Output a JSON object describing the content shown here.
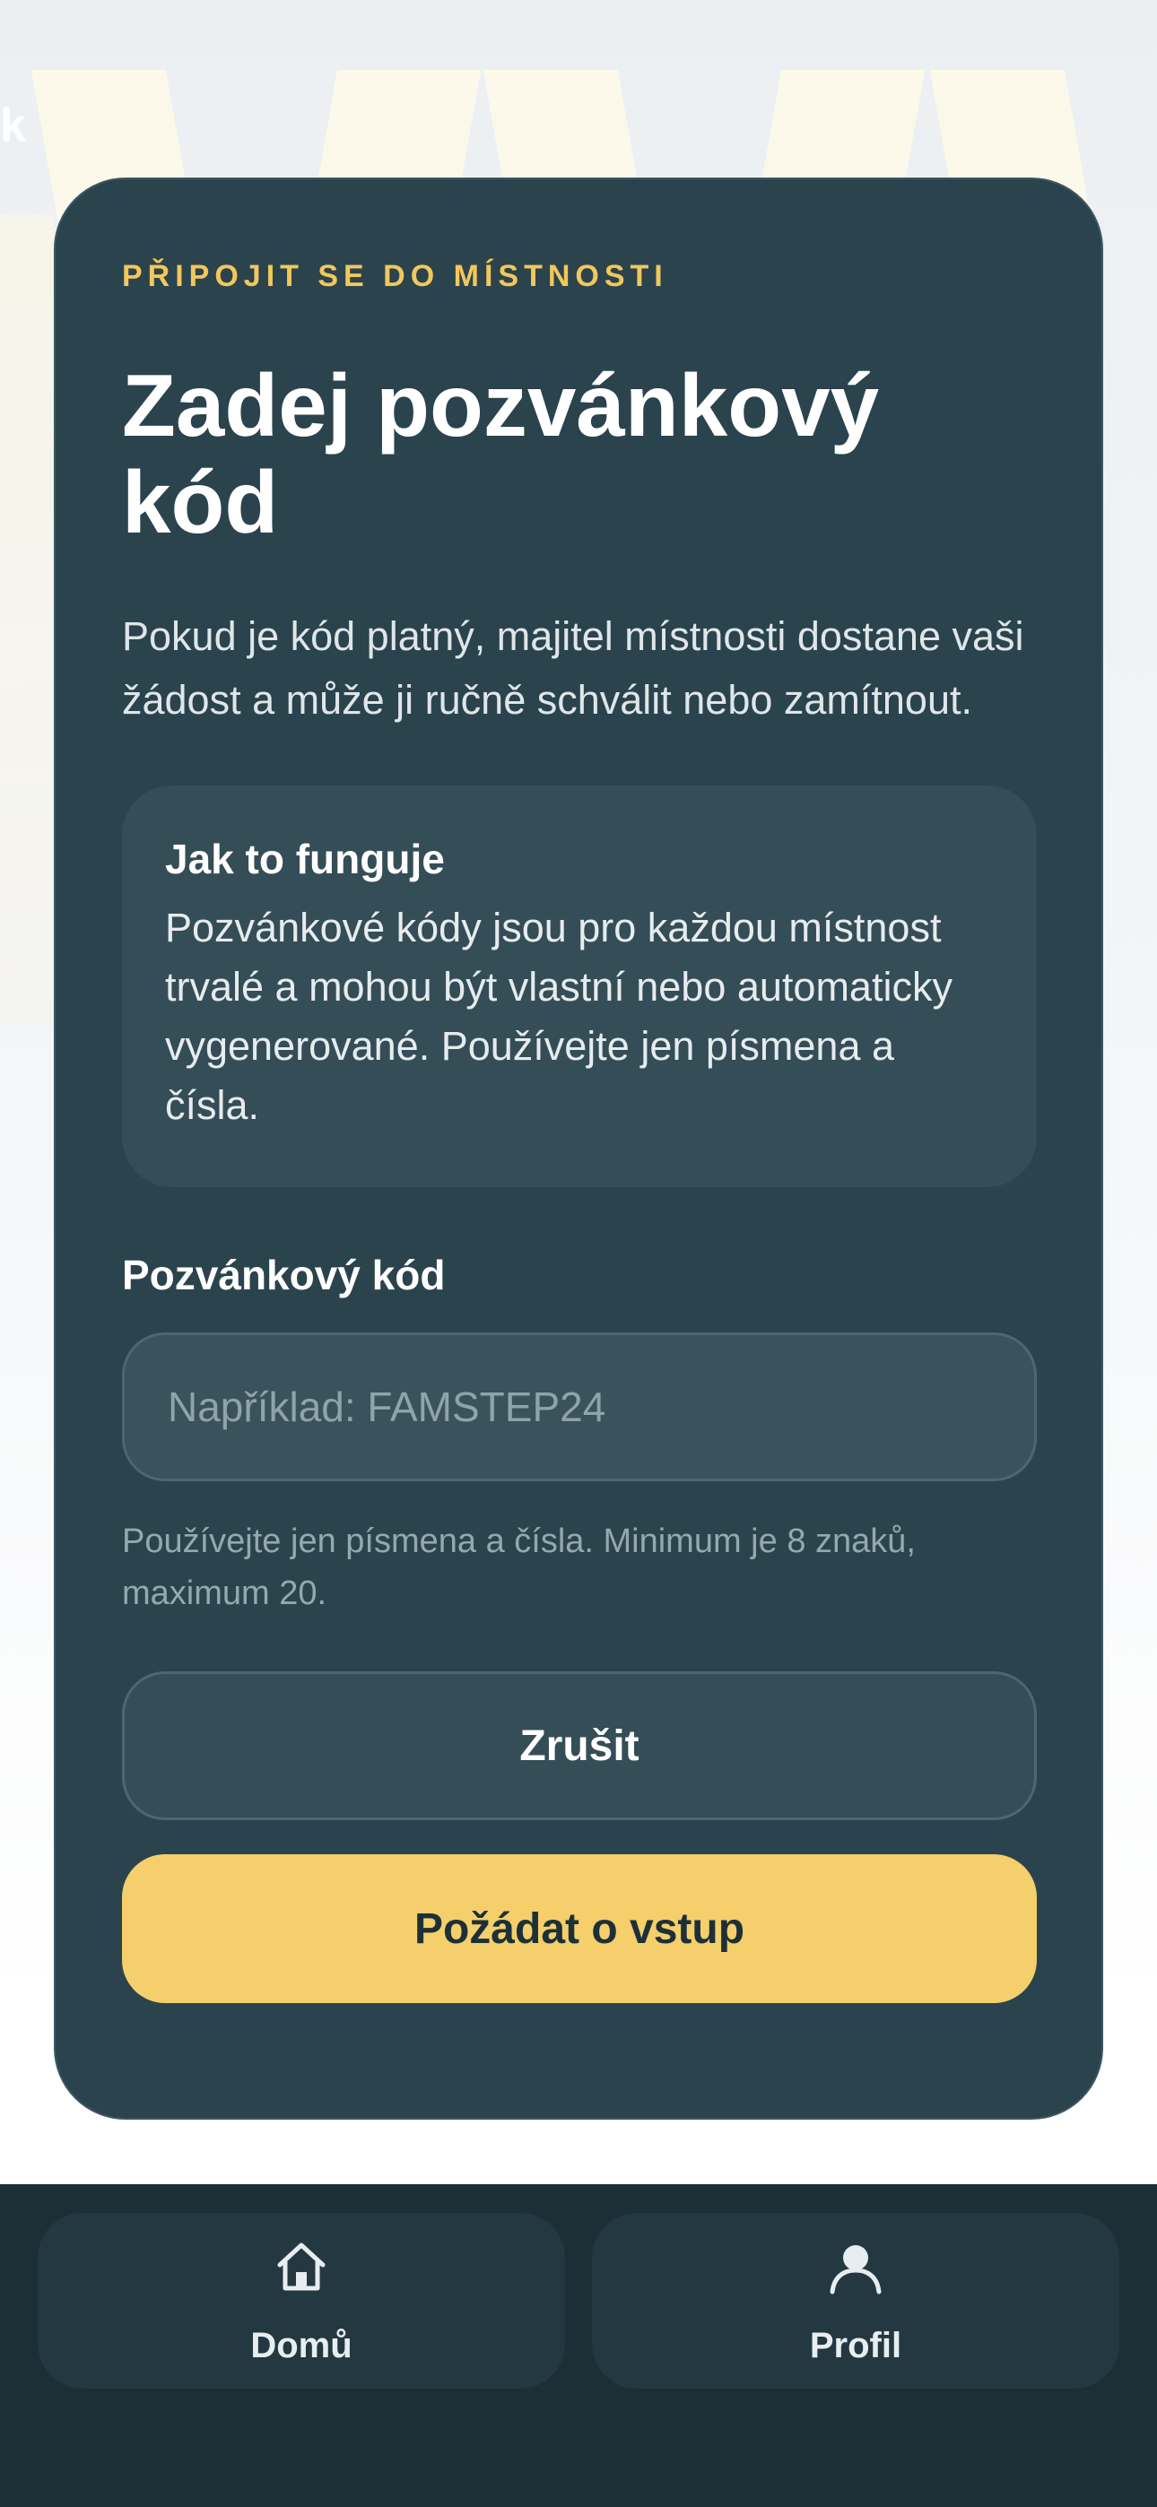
{
  "background": {
    "corner_glyph": "k"
  },
  "card": {
    "eyebrow": "PŘIPOJIT SE DO MÍSTNOSTI",
    "title": "Zadej pozvánkový kód",
    "description": "Pokud je kód platný, majitel místnosti dostane vaši žádost a může ji ručně schválit nebo zamítnout.",
    "info": {
      "title": "Jak to funguje",
      "text": "Pozvánkové kódy jsou pro každou místnost trvalé a mohou být vlastní nebo automaticky vygenerované. Používejte jen písmena a čísla."
    },
    "field": {
      "label": "Pozvánkový kód",
      "value": "",
      "placeholder": "Například: FAMSTEP24",
      "hint": "Používejte jen písmena a čísla. Minimum je 8 znaků, maximum 20."
    },
    "buttons": {
      "cancel_label": "Zrušit",
      "submit_label": "Požádat o vstup"
    }
  },
  "bottom_nav": {
    "items": [
      {
        "label": "Domů",
        "icon": "home-icon"
      },
      {
        "label": "Profil",
        "icon": "user-icon"
      }
    ]
  },
  "colors": {
    "card_background": "#2b434d",
    "accent": "#f4cf6b",
    "eyebrow": "#f2c75c",
    "nav_background": "#1c2e36"
  }
}
